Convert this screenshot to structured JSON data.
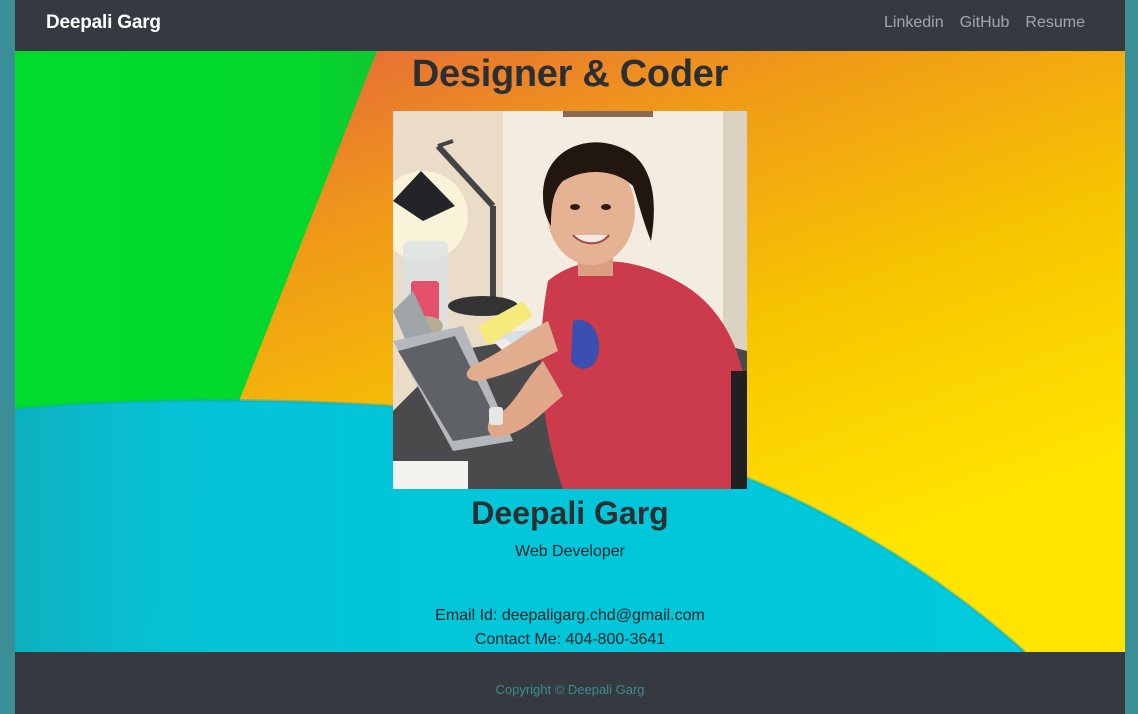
{
  "navbar": {
    "brand": "Deepali Garg",
    "links": [
      "Linkedin",
      "GitHub",
      "Resume"
    ]
  },
  "hero": {
    "headline": "Designer & Coder",
    "name": "Deepali Garg",
    "role": "Web Developer",
    "email_text": "Email Id: deepaligarg.chd@gmail.com",
    "phone_text": "Contact Me: 404-800-3641"
  },
  "footer": {
    "copyright": "Copyright © Deepali Garg"
  },
  "colors": {
    "navbar_bg": "#343a40",
    "accent_green": "#00dc2e",
    "accent_cyan": "#00c8dc",
    "accent_yellow": "#ffe400",
    "accent_orange": "#f09a18",
    "footer_text": "#3d8b8e"
  }
}
